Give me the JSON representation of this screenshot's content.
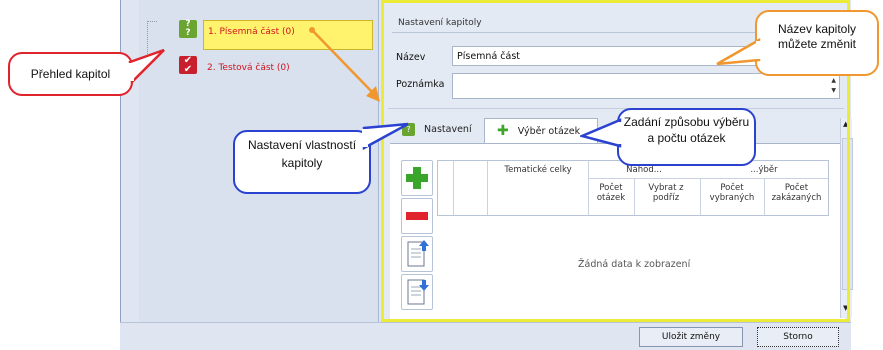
{
  "tree": {
    "items": [
      {
        "label": "1. Písemná část (0)",
        "selected": true
      },
      {
        "label": "2. Testová část (0)",
        "selected": false
      }
    ]
  },
  "settings": {
    "group_title": "Nastavení kapitoly",
    "name_label": "Název",
    "name_value": "Písemná část",
    "note_label": "Poznámka",
    "note_value": ""
  },
  "tabs": [
    {
      "label": "Nastavení",
      "active": false
    },
    {
      "label": "Výběr otázek",
      "active": true
    }
  ],
  "grid": {
    "col_tematicke": "Tematické celky",
    "group_nahodny": "Náhod...",
    "group_vyber": "...ýběr",
    "col_pocet_otazek": "Počet otázek",
    "col_vybrat_z_podriz": "Vybrat z podříz",
    "col_pocet_vybranych": "Počet vybraných",
    "col_pocet_zakazanych": "Počet zakázaných",
    "empty_text": "Žádná data k zobrazení"
  },
  "footer": {
    "save_label": "Uložit změny",
    "cancel_label": "Storno"
  },
  "callouts": {
    "prehled": "Přehled kapitol",
    "nazev": "Název kapitoly můžete změnit",
    "nastaveni": "Nastavení vlastností kapitoly",
    "zadani": "Zadání způsobu výběru a počtu otázek"
  },
  "colors": {
    "callout_red": "#e0242c",
    "callout_orange": "#f0972f",
    "callout_blue": "#2b42d1",
    "highlight_yellow": "#ecec38"
  }
}
